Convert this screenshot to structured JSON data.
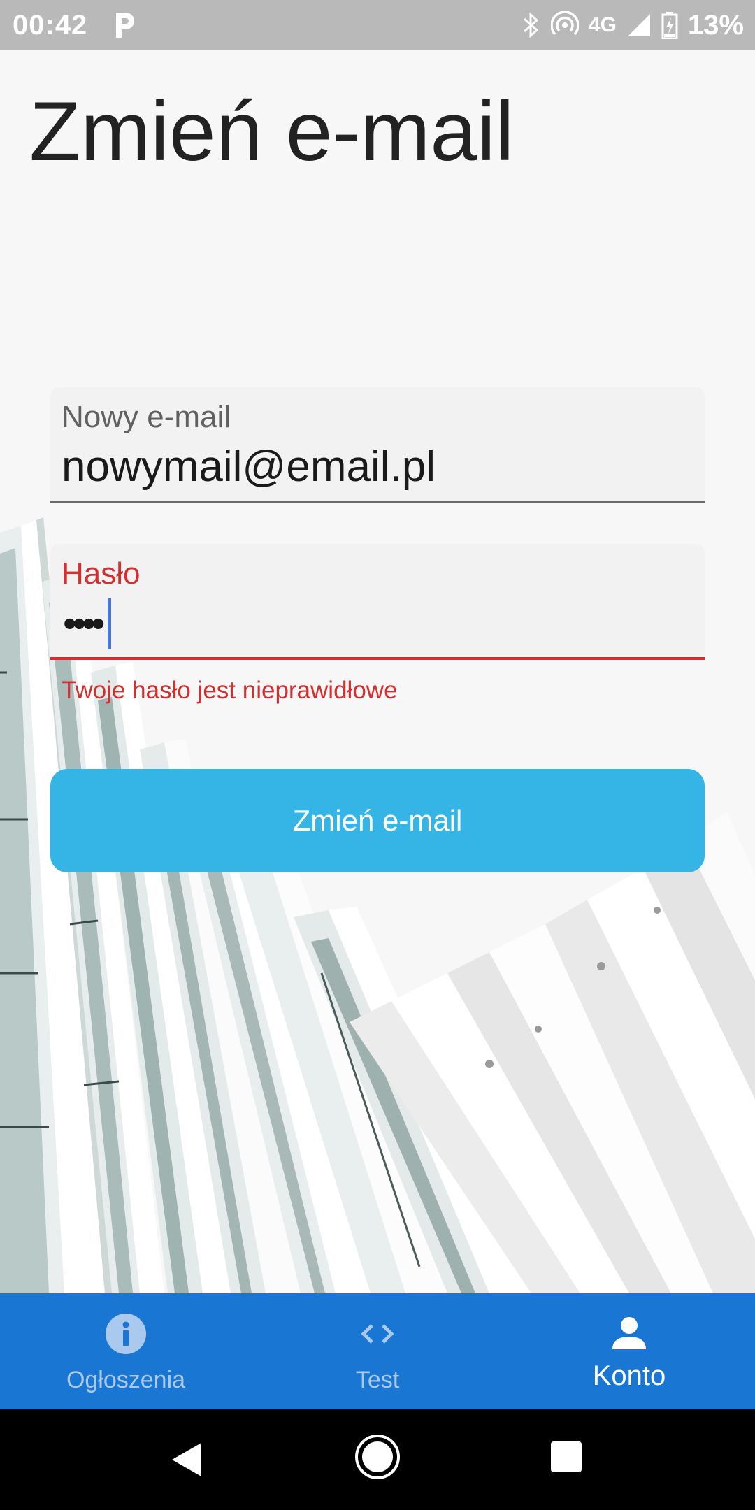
{
  "status_bar": {
    "time": "00:42",
    "network": "4G",
    "battery": "13%"
  },
  "page": {
    "title": "Zmień e-mail"
  },
  "form": {
    "email_field": {
      "label": "Nowy e-mail",
      "value": "nowymail@email.pl"
    },
    "password_field": {
      "label": "Hasło",
      "masked_value": "••••",
      "error": "Twoje hasło jest nieprawidłowe"
    },
    "submit_label": "Zmień e-mail"
  },
  "bottom_nav": {
    "items": [
      {
        "label": "Ogłoszenia",
        "icon": "info-icon",
        "active": false
      },
      {
        "label": "Test",
        "icon": "code-icon",
        "active": false
      },
      {
        "label": "Konto",
        "icon": "person-icon",
        "active": true
      }
    ]
  },
  "system_nav": {
    "buttons": [
      "back-icon",
      "home-icon",
      "recents-icon"
    ]
  },
  "colors": {
    "status_bar": "#b9b9b9",
    "primary_button": "#34b5e5",
    "bottom_nav": "#1976d2",
    "error": "#d32f2f",
    "nav_inactive": "#a9c9ee",
    "nav_active": "#ffffff"
  }
}
